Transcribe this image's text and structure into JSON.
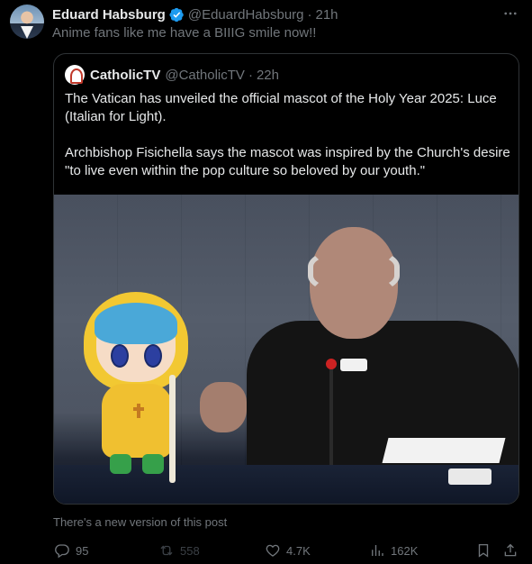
{
  "author": {
    "display_name": "Eduard Habsburg",
    "handle": "@EduardHabsburg",
    "separator": "·",
    "time": "21h"
  },
  "tweet": {
    "text": "Anime fans like me have a BIIIG smile now!!"
  },
  "quoted": {
    "display_name": "CatholicTV",
    "handle": "@CatholicTV",
    "separator": "·",
    "time": "22h",
    "paragraph_1": "The Vatican has unveiled the official mascot of the Holy Year 2025: Luce (Italian for Light).",
    "paragraph_2": "Archbishop Fisichella says the mascot was inspired by the Church's desire \"to live even within the pop culture so beloved by our youth.\""
  },
  "notice": "There's a new version of this post",
  "metrics": {
    "replies": "95",
    "reposts": "558",
    "likes": "4.7K",
    "views": "162K"
  },
  "icons": {
    "verified": "verified-badge-icon",
    "more": "more-icon",
    "reply": "reply-icon",
    "repost": "repost-icon",
    "like": "heart-icon",
    "views": "views-icon",
    "bookmark": "bookmark-icon",
    "share": "share-icon"
  },
  "colors": {
    "background": "#000000",
    "text_primary": "#e7e9ea",
    "text_secondary": "#71767b",
    "verified_blue": "#1d9bf0",
    "border": "#2f3336",
    "disabled": "#3b4046"
  }
}
